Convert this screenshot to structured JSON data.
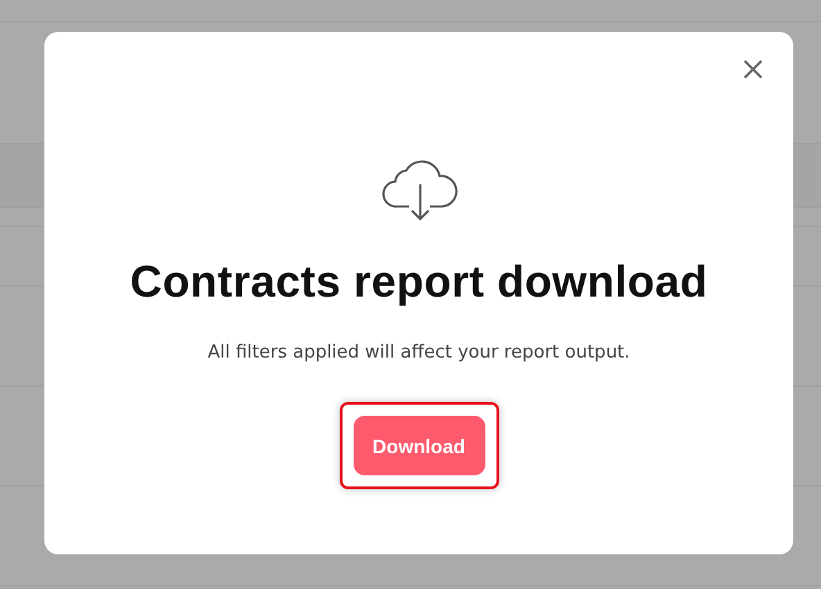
{
  "dialog": {
    "title": "Contracts report download",
    "message": "All filters applied will affect your report output.",
    "button": {
      "label": "Download",
      "focused": true
    }
  }
}
